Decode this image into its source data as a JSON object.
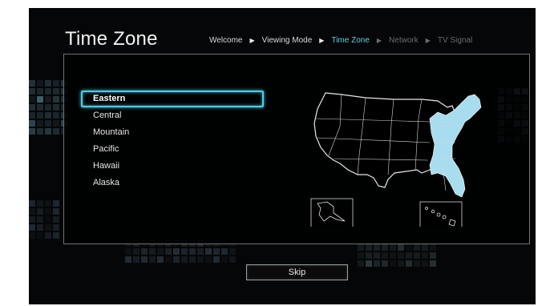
{
  "header": {
    "title": "Time Zone",
    "steps": [
      {
        "label": "Welcome",
        "state": "done"
      },
      {
        "label": "Viewing Mode",
        "state": "done"
      },
      {
        "label": "Time Zone",
        "state": "active"
      },
      {
        "label": "Network",
        "state": "pending"
      },
      {
        "label": "TV Signal",
        "state": "pending"
      }
    ]
  },
  "zones": [
    "Eastern",
    "Central",
    "Mountain",
    "Pacific",
    "Hawaii",
    "Alaska"
  ],
  "selected_zone": "Eastern",
  "skip_label": "Skip",
  "colors": {
    "accent": "#5fd0e6",
    "highlight_region": "#a8dcef",
    "background": "#050607"
  }
}
